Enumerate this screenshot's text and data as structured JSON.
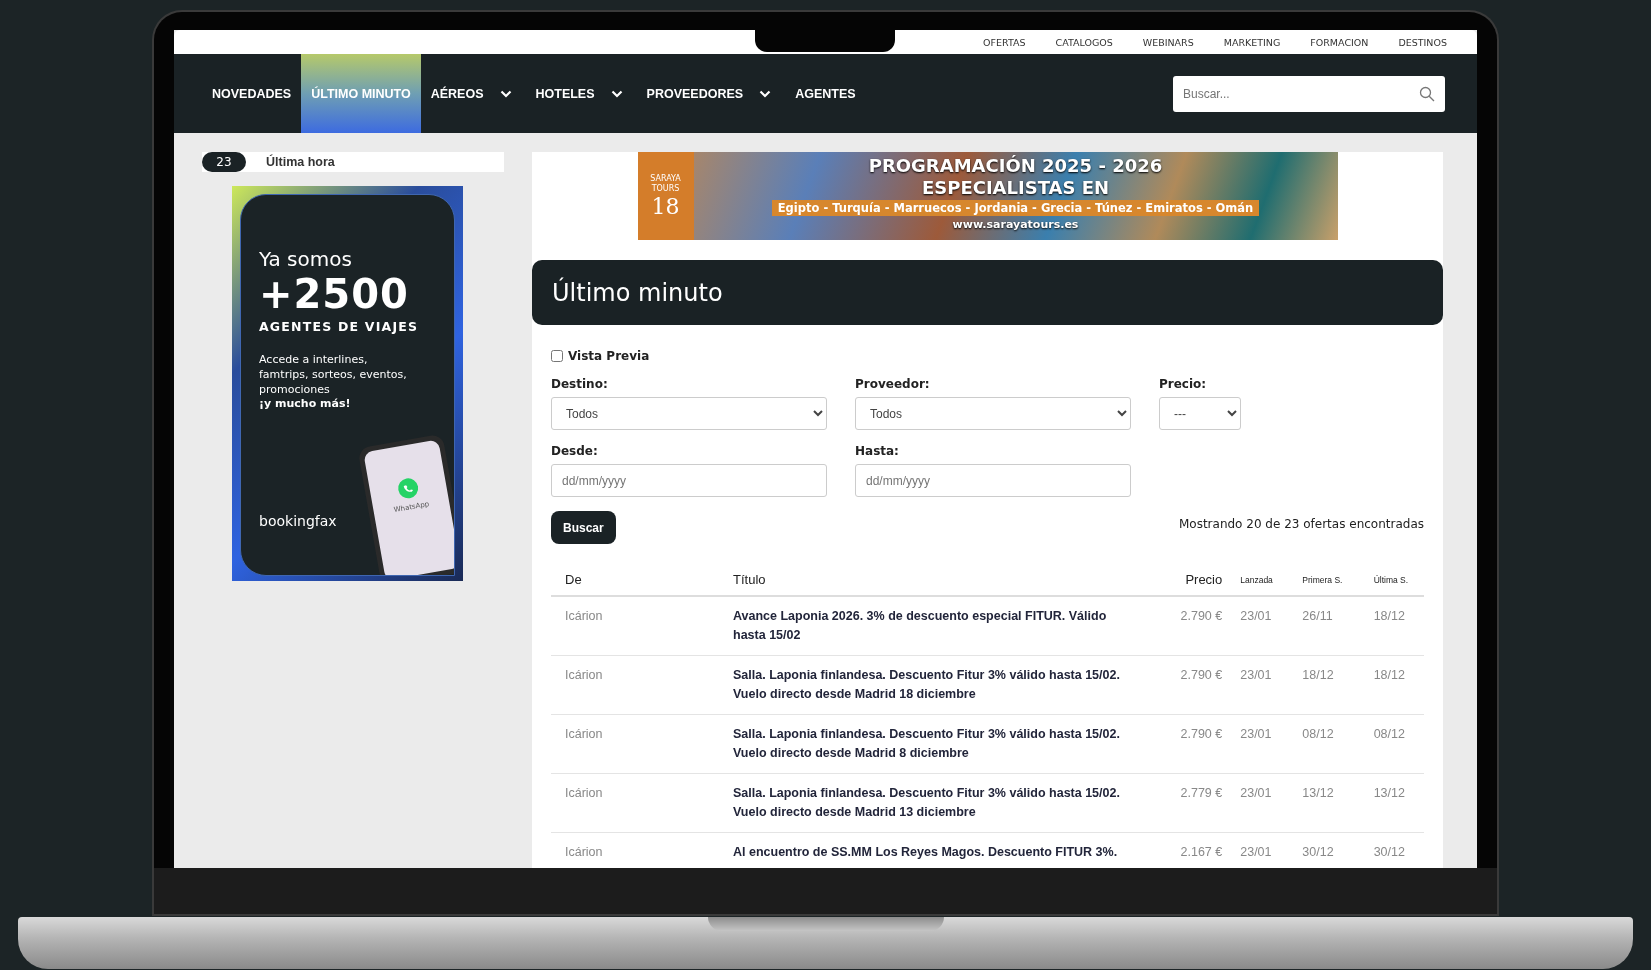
{
  "top_links": [
    "OFERTAS",
    "CATALOGOS",
    "WEBINARS",
    "MARKETING",
    "FORMACION",
    "DESTINOS"
  ],
  "nav": [
    {
      "label": "NOVEDADES",
      "selected": false,
      "dropdown": false
    },
    {
      "label": "ÚLTIMO MINUTO",
      "selected": true,
      "dropdown": false
    },
    {
      "label": "AÉREOS",
      "selected": false,
      "dropdown": true
    },
    {
      "label": "HOTELES",
      "selected": false,
      "dropdown": true
    },
    {
      "label": "PROVEEDORES",
      "selected": false,
      "dropdown": true
    },
    {
      "label": "AGENTES",
      "selected": false,
      "dropdown": false
    }
  ],
  "search": {
    "placeholder": "Buscar..."
  },
  "ticker": {
    "count": "23",
    "label": "Última hora"
  },
  "side_ad": {
    "intro": "Ya somos",
    "number": "+2500",
    "subtitle": "AGENTES DE VIAJES",
    "text": "Accede a interlines, famtrips, sorteos, eventos, promociones",
    "highlight": "¡y mucho más!",
    "phone_label": "WhatsApp",
    "brand": "bookingfax"
  },
  "banner": {
    "logo_name": "SARAYA TOURS",
    "logo_years": "18",
    "line1": "PROGRAMACIÓN 2025 - 2026",
    "line2": "ESPECIALISTAS EN",
    "destinations": "Egipto - Turquía - Marruecos - Jordania - Grecia - Túnez - Emiratos - Omán",
    "url": "www.sarayatours.es"
  },
  "page_title": "Último minuto",
  "preview": {
    "label": "Vista Previa",
    "checked": false
  },
  "filters": [
    {
      "label": "Destino:",
      "kind": "select",
      "value": "Todos"
    },
    {
      "label": "Proveedor:",
      "kind": "select",
      "value": "Todos"
    },
    {
      "label": "Precio:",
      "kind": "shortselect",
      "value": "---"
    },
    {
      "label": "Desde:",
      "kind": "date",
      "placeholder": "dd/mm/yyyy"
    },
    {
      "label": "Hasta:",
      "kind": "date",
      "placeholder": "dd/mm/yyyy"
    }
  ],
  "search_button": "Buscar",
  "results_count": "Mostrando 20 de 23 ofertas encontradas",
  "table": {
    "columns": [
      "De",
      "Título",
      "Precio",
      "Lanzada",
      "Primera S.",
      "Última S."
    ],
    "rows": [
      [
        "Icárion",
        "Avance Laponia 2026. 3% de descuento especial FITUR. Válido hasta 15/02",
        "2.790 €",
        "23/01",
        "26/11",
        "18/12"
      ],
      [
        "Icárion",
        "Salla. Laponia finlandesa. Descuento Fitur 3% válido hasta 15/02. Vuelo directo desde Madrid 18 diciembre",
        "2.790 €",
        "23/01",
        "18/12",
        "18/12"
      ],
      [
        "Icárion",
        "Salla. Laponia finlandesa. Descuento Fitur 3% válido hasta 15/02. Vuelo directo desde Madrid 8 diciembre",
        "2.790 €",
        "23/01",
        "08/12",
        "08/12"
      ],
      [
        "Icárion",
        "Salla. Laponia finlandesa. Descuento Fitur 3% válido hasta 15/02. Vuelo directo desde Madrid 13 diciembre",
        "2.779 €",
        "23/01",
        "13/12",
        "13/12"
      ],
      [
        "Icárion",
        "Al encuentro de SS.MM Los Reyes Magos. Descuento FITUR 3%.",
        "2.167 €",
        "23/01",
        "30/12",
        "30/12"
      ]
    ]
  }
}
